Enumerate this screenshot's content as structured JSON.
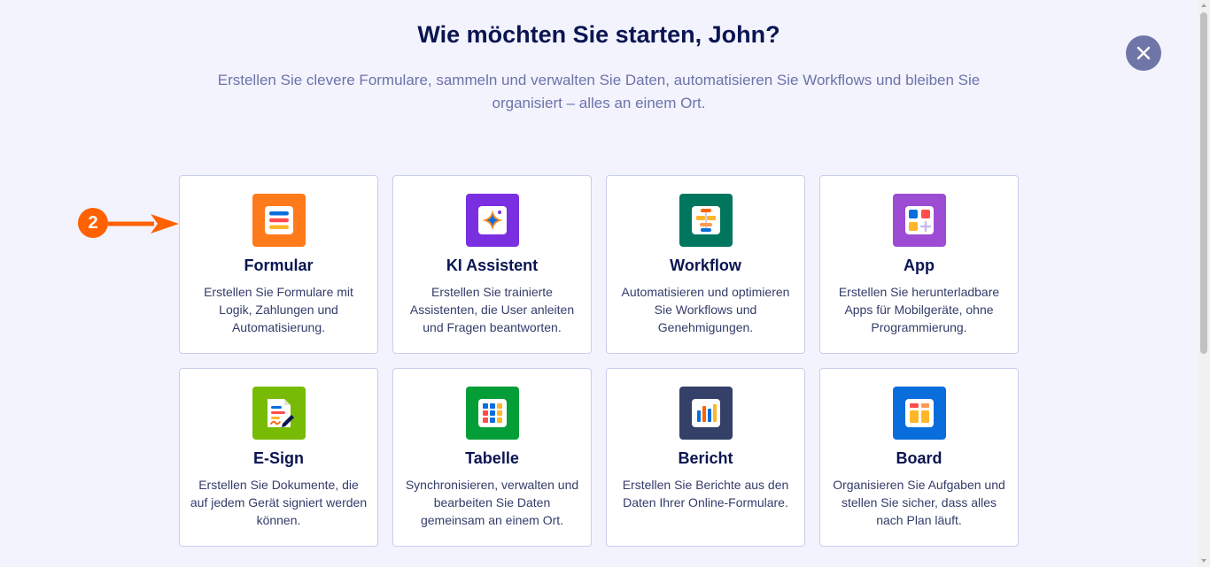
{
  "header": {
    "title": "Wie möchten Sie starten, John?",
    "subtitle": "Erstellen Sie clevere Formulare, sammeln und verwalten Sie Daten, automatisieren Sie Workflows und bleiben Sie organisiert – alles an einem Ort."
  },
  "close_icon": "close-icon",
  "annotation": {
    "step_number": "2",
    "color": "#ff6100"
  },
  "cards": [
    {
      "id": "formular",
      "title": "Formular",
      "description": "Erstellen Sie Formulare mit Logik, Zahlungen und Automatisierung.",
      "icon": "form-icon",
      "color": "#ff7a1a"
    },
    {
      "id": "ki-assistent",
      "title": "KI Assistent",
      "description": "Erstellen Sie trainierte Assistenten, die User anleiten und Fragen beantworten.",
      "icon": "ai-sparkle-icon",
      "color": "#7a2fe0"
    },
    {
      "id": "workflow",
      "title": "Workflow",
      "description": "Automatisieren und optimieren Sie Workflows und Genehmigungen.",
      "icon": "workflow-icon",
      "color": "#00765f"
    },
    {
      "id": "app",
      "title": "App",
      "description": "Erstellen Sie herunterladbare Apps für Mobilgeräte, ohne Programmierung.",
      "icon": "app-icon",
      "color": "#9c4dd3"
    },
    {
      "id": "e-sign",
      "title": "E-Sign",
      "description": "Erstellen Sie Dokumente, die auf jedem Gerät signiert werden können.",
      "icon": "esign-icon",
      "color": "#78bb07"
    },
    {
      "id": "tabelle",
      "title": "Tabelle",
      "description": "Synchronisieren, verwalten und bearbeiten Sie Daten gemeinsam an einem Ort.",
      "icon": "table-icon",
      "color": "#049e38"
    },
    {
      "id": "bericht",
      "title": "Bericht",
      "description": "Erstellen Sie Berichte aus den Daten Ihrer Online-Formulare.",
      "icon": "report-icon",
      "color": "#344067"
    },
    {
      "id": "board",
      "title": "Board",
      "description": "Organisieren Sie Aufgaben und stellen Sie sicher, dass alles nach Plan läuft.",
      "icon": "board-icon",
      "color": "#0a6ddc"
    }
  ]
}
